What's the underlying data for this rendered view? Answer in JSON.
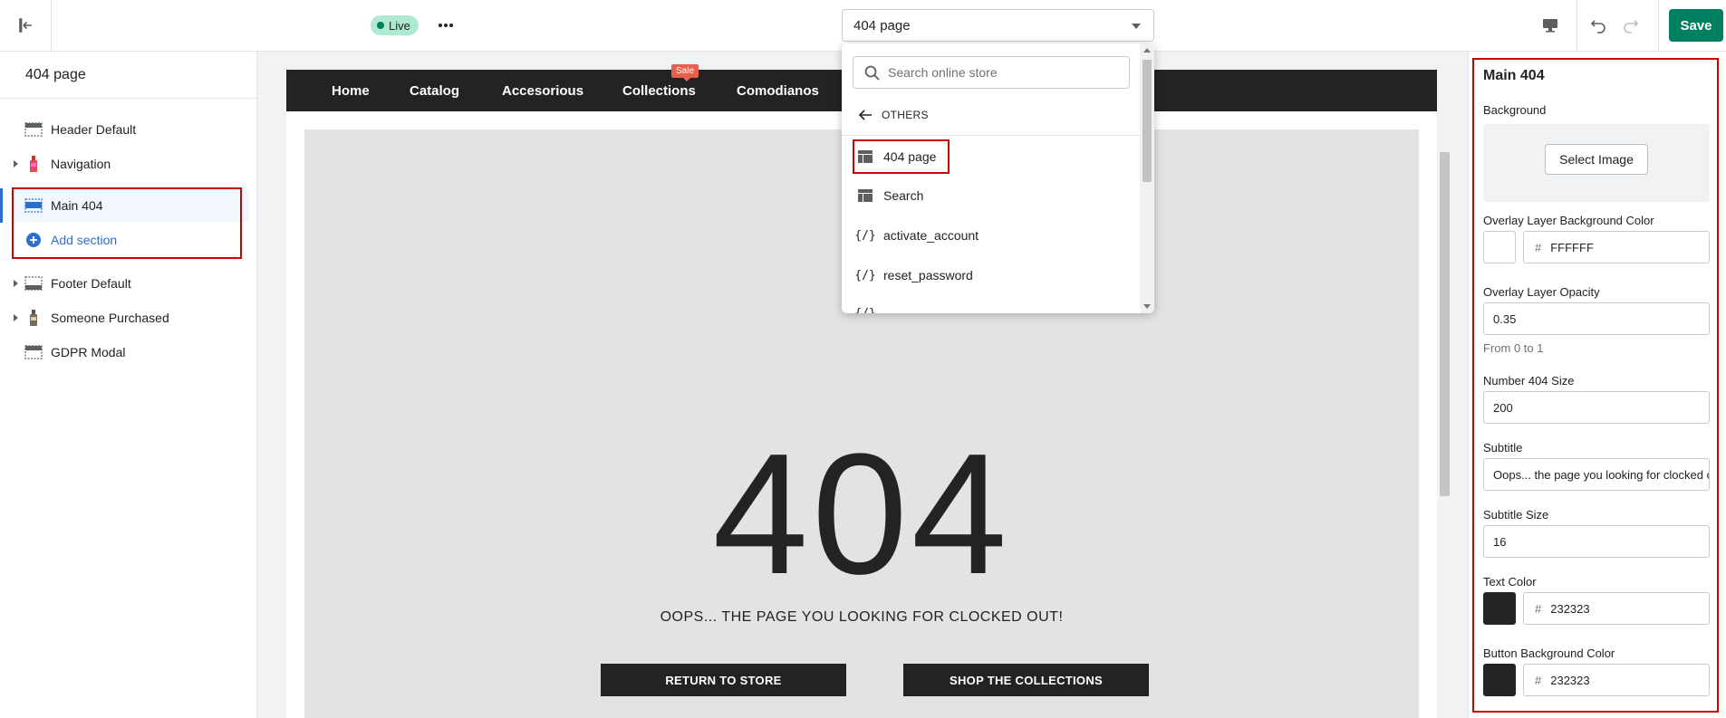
{
  "topbar": {
    "live_label": "Live",
    "page_select_value": "404 page",
    "save_label": "Save"
  },
  "left_panel": {
    "title": "404 page",
    "sections": [
      {
        "label": "Header Default",
        "icon": "header-layout-icon",
        "expandable": false
      },
      {
        "label": "Navigation",
        "icon": "product-thumbnail-icon",
        "expandable": true
      },
      {
        "label": "Main 404",
        "icon": "section-layout-icon",
        "expandable": false,
        "selected": true
      },
      {
        "label": "Add section",
        "icon": "plus-circle-icon",
        "expandable": false
      },
      {
        "label": "Footer Default",
        "icon": "footer-layout-icon",
        "expandable": true
      },
      {
        "label": "Someone Purchased",
        "icon": "product-thumbnail-icon",
        "expandable": true
      },
      {
        "label": "GDPR Modal",
        "icon": "modal-layout-icon",
        "expandable": false
      }
    ]
  },
  "preview": {
    "nav": [
      "Home",
      "Catalog",
      "Accesorious",
      "Collections",
      "Comodianos"
    ],
    "sale_tag": "Sale",
    "number": "404",
    "subtitle": "OOPS... THE PAGE YOU LOOKING FOR CLOCKED OUT!",
    "button_return": "RETURN TO STORE",
    "button_shop": "SHOP THE COLLECTIONS",
    "colors": {
      "nav_bg": "#232323",
      "hero_bg": "#e3e3e3",
      "sale": "#e8604c"
    }
  },
  "dropdown": {
    "search_placeholder": "Search online store",
    "back_label": "OTHERS",
    "items": [
      {
        "label": "404 page",
        "icon": "page-template-icon",
        "highlighted": true
      },
      {
        "label": "Search",
        "icon": "page-template-icon"
      },
      {
        "label": "activate_account",
        "icon": "code-braces-icon"
      },
      {
        "label": "reset_password",
        "icon": "code-braces-icon"
      },
      {
        "label": "…",
        "icon": "code-braces-icon"
      }
    ]
  },
  "settings": {
    "title": "Main 404",
    "background_label": "Background",
    "select_image_label": "Select Image",
    "overlay_bg_label": "Overlay Layer Background Color",
    "overlay_bg_value": "FFFFFF",
    "overlay_opacity_label": "Overlay Layer Opacity",
    "overlay_opacity_value": "0.35",
    "overlay_opacity_help": "From 0 to 1",
    "number_size_label": "Number 404 Size",
    "number_size_value": "200",
    "subtitle_label": "Subtitle",
    "subtitle_value": "Oops... the page you looking for clocked out!",
    "subtitle_size_label": "Subtitle Size",
    "subtitle_size_value": "16",
    "text_color_label": "Text Color",
    "text_color_value": "232323",
    "button_bg_label": "Button Background Color",
    "button_bg_value": "232323",
    "hash": "#"
  }
}
